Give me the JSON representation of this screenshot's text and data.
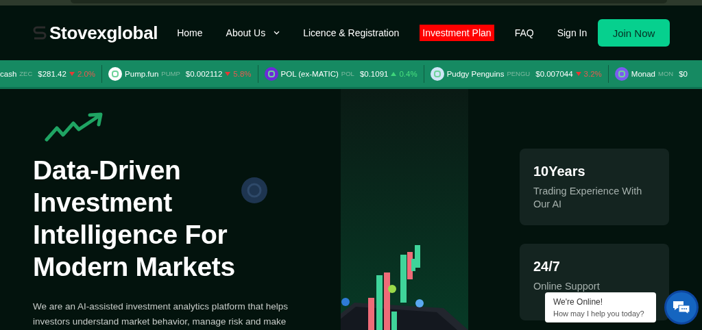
{
  "header": {
    "logo": "Stovexglobal",
    "nav": [
      {
        "label": "Home",
        "selected": false,
        "has_menu": false
      },
      {
        "label": "About Us",
        "selected": false,
        "has_menu": true
      },
      {
        "label": "Licence & Registration",
        "selected": false,
        "has_menu": false
      },
      {
        "label": "Investment Plan",
        "selected": true,
        "has_menu": false
      },
      {
        "label": "FAQ",
        "selected": false,
        "has_menu": false
      },
      {
        "label": "Sign In",
        "selected": false,
        "has_menu": false
      }
    ],
    "cta": "Join Now"
  },
  "ticker": [
    {
      "name": "cash",
      "symbol": "ZEC",
      "price": "$281.42",
      "change": "2.0%",
      "rising": false
    },
    {
      "name": "Pump.fun",
      "symbol": "PUMP",
      "price": "$0.002112",
      "change": "5.8%",
      "rising": false,
      "color": "#ffffff"
    },
    {
      "name": "POL (ex-MATIC)",
      "symbol": "POL",
      "price": "$0.1091",
      "change": "0.4%",
      "rising": true,
      "color": "#6c2bd9"
    },
    {
      "name": "Pudgy Penguins",
      "symbol": "PENGU",
      "price": "$0.007044",
      "change": "3.2%",
      "rising": false,
      "color": "#cfe6f7"
    },
    {
      "name": "Monad",
      "symbol": "MON",
      "price": "$0",
      "color": "#7b5cf0"
    }
  ],
  "hero": {
    "headline": "Data-Driven Investment Intelligence For Modern Markets",
    "text": "We are an AI-assisted investment analytics platform that helps investors understand market behavior, manage risk and make"
  },
  "stats": [
    {
      "value": "10Years",
      "label": "Trading Experience With Our AI"
    },
    {
      "value": "24/7",
      "label": "Online Support"
    }
  ],
  "chat": {
    "title": "We're Online!",
    "subtitle": "How may I help you today?"
  }
}
